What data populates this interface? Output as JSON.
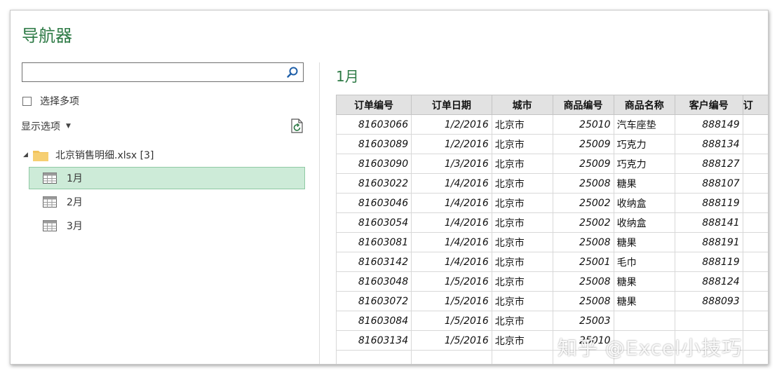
{
  "window": {
    "title": "导航器"
  },
  "search": {
    "value": "",
    "placeholder": ""
  },
  "multi_select": {
    "label": "选择多项",
    "checked": false
  },
  "display_options": {
    "label": "显示选项"
  },
  "tree": {
    "root_label": "北京销售明细.xlsx [3]",
    "items": [
      {
        "label": "1月",
        "selected": true
      },
      {
        "label": "2月",
        "selected": false
      },
      {
        "label": "3月",
        "selected": false
      }
    ]
  },
  "preview": {
    "title": "1月",
    "columns": [
      "订单编号",
      "订单日期",
      "城市",
      "商品编号",
      "商品名称",
      "客户编号",
      "订"
    ],
    "rows": [
      [
        "81603066",
        "1/2/2016",
        "北京市",
        "25010",
        "汽车座垫",
        "888149"
      ],
      [
        "81603089",
        "1/2/2016",
        "北京市",
        "25009",
        "巧克力",
        "888134"
      ],
      [
        "81603090",
        "1/3/2016",
        "北京市",
        "25009",
        "巧克力",
        "888127"
      ],
      [
        "81603022",
        "1/4/2016",
        "北京市",
        "25008",
        "糖果",
        "888107"
      ],
      [
        "81603046",
        "1/4/2016",
        "北京市",
        "25002",
        "收纳盒",
        "888119"
      ],
      [
        "81603054",
        "1/4/2016",
        "北京市",
        "25002",
        "收纳盒",
        "888141"
      ],
      [
        "81603081",
        "1/4/2016",
        "北京市",
        "25008",
        "糖果",
        "888191"
      ],
      [
        "81603142",
        "1/4/2016",
        "北京市",
        "25001",
        "毛巾",
        "888119"
      ],
      [
        "81603048",
        "1/5/2016",
        "北京市",
        "25008",
        "糖果",
        "888124"
      ],
      [
        "81603072",
        "1/5/2016",
        "北京市",
        "25008",
        "糖果",
        "888093"
      ],
      [
        "81603084",
        "1/5/2016",
        "北京市",
        "25003",
        "",
        ""
      ],
      [
        "81603134",
        "1/5/2016",
        "北京市",
        "25010",
        "",
        ""
      ],
      [
        "",
        "",
        "",
        "",
        "",
        ""
      ]
    ]
  },
  "watermark": "知乎 @Excel小技巧",
  "colors": {
    "accent_green": "#2d7a45",
    "selected_bg": "#cdebd8",
    "header_bg": "#e2e2e2",
    "folder": "#f2c35a"
  },
  "icons": [
    "search-icon",
    "refresh-icon",
    "folder-icon",
    "sheet-icon",
    "expand-arrow-icon",
    "dropdown-caret-icon"
  ]
}
